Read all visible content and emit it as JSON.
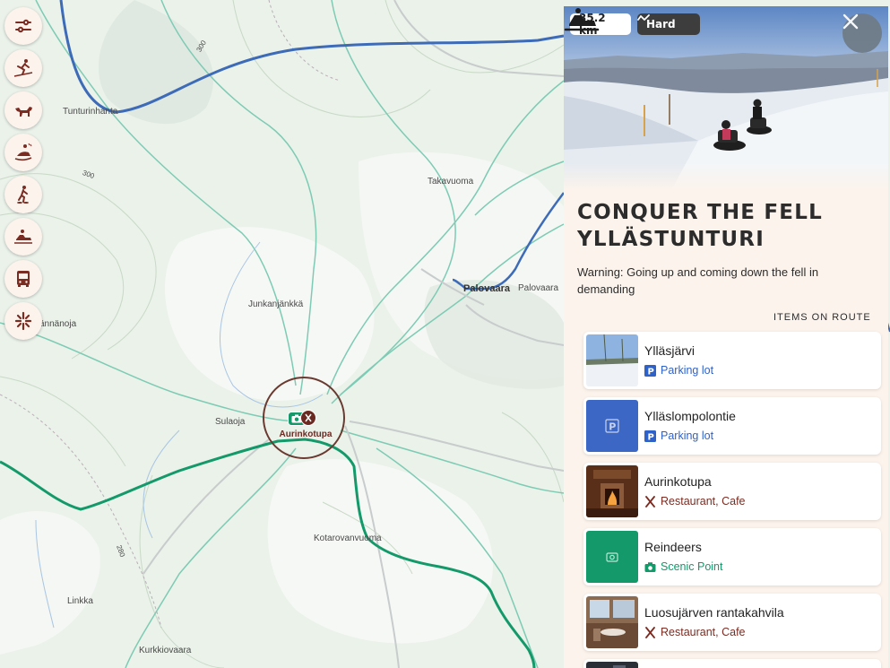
{
  "map": {
    "labels": [
      "Tunturinhanta",
      "300",
      "300",
      "Takavuoma",
      "Junkanjänkkä",
      "Palovaara",
      "Palovaara",
      "ännänoja",
      "Sulaoja",
      "Kotarovanvuoma",
      "280",
      "Linkka",
      "Kurkkiovaara"
    ]
  },
  "toolbar": {
    "buttons": [
      {
        "name": "filter-sliders-icon"
      },
      {
        "name": "cross-country-skiing-icon"
      },
      {
        "name": "dog-icon"
      },
      {
        "name": "snowmobile-sled-icon"
      },
      {
        "name": "snowshoe-hiking-icon"
      },
      {
        "name": "snowmobile-icon"
      },
      {
        "name": "bus-icon"
      },
      {
        "name": "sparkle-services-icon"
      }
    ]
  },
  "marker": {
    "label": "Aurinkotupa"
  },
  "route": {
    "distance": "35.2 km",
    "difficulty": "Hard",
    "title_line1": "CONQUER THE FELL",
    "title_line2": "YLLÄSTUNTURI",
    "warning": "Warning: Going up and coming down the fell in demanding",
    "items_heading": "ITEMS ON ROUTE",
    "items": [
      {
        "name": "Ylläsjärvi",
        "category": "Parking lot",
        "type": "parking"
      },
      {
        "name": "Ylläslompolontie",
        "category": "Parking lot",
        "type": "parking"
      },
      {
        "name": "Aurinkotupa",
        "category": "Restaurant, Cafe",
        "type": "food"
      },
      {
        "name": "Reindeers",
        "category": "Scenic Point",
        "type": "scenic"
      },
      {
        "name": "Luosujärven rantakahvila",
        "category": "Restaurant, Cafe",
        "type": "food"
      }
    ]
  },
  "colors": {
    "route_green": "#13996a",
    "road_blue": "#3d6bb8",
    "parking_blue": "#2f62c8",
    "restaurant_brown": "#7a2c22",
    "panel_bg": "#fcf3ec"
  }
}
